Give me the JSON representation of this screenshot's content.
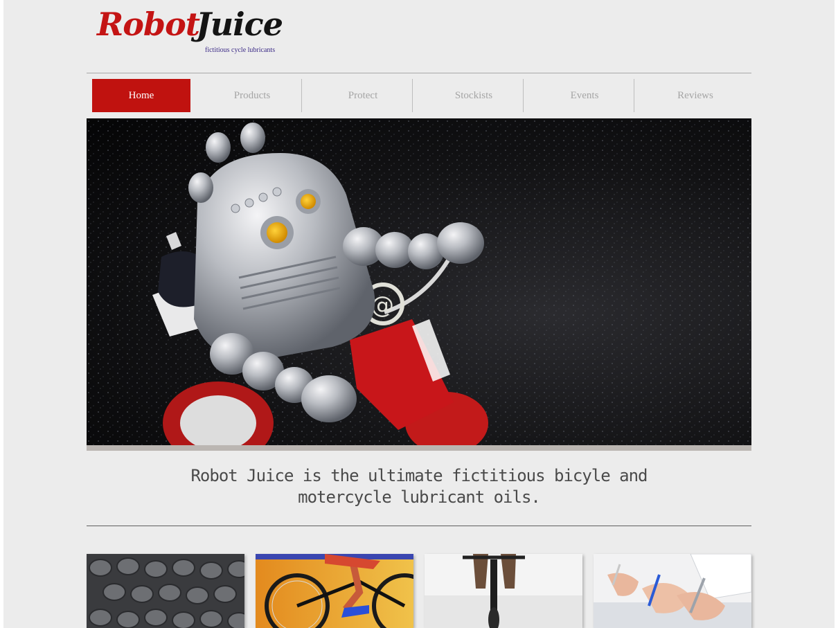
{
  "brand": {
    "name_part1": "Robot",
    "name_part2": "Juice",
    "tagline": "fictitious cycle lubricants",
    "colors": {
      "red": "#c0120f",
      "dark": "#141414",
      "tagline": "#3b2a86"
    }
  },
  "nav": {
    "items": [
      {
        "label": "Home",
        "active": true
      },
      {
        "label": "Products",
        "active": false
      },
      {
        "label": "Protect",
        "active": false
      },
      {
        "label": "Stockists",
        "active": false
      },
      {
        "label": "Events",
        "active": false
      },
      {
        "label": "Reviews",
        "active": false
      }
    ]
  },
  "hero": {
    "image": "toy-robot-riding-tricycle-photo"
  },
  "intro": {
    "text": "Robot Juice is the ultimate fictitious bicyle and motercycle lubricant oils."
  },
  "thumbnails": [
    {
      "image": "bike-chain-photo"
    },
    {
      "image": "cyclist-on-track-bike-photo"
    },
    {
      "image": "road-cyclist-photo"
    },
    {
      "image": "hands-writing-documents-photo"
    }
  ]
}
